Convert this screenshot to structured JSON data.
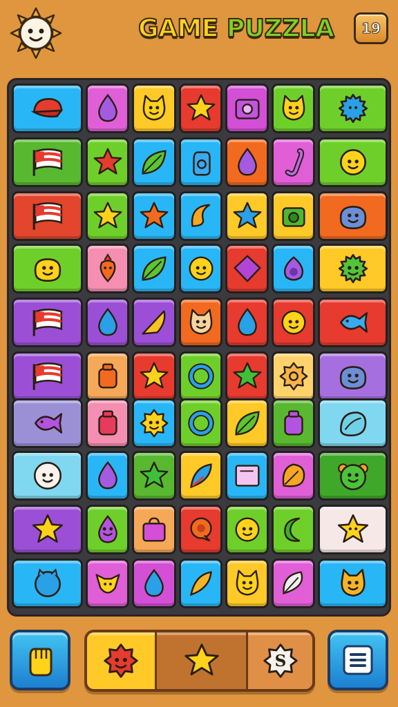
{
  "header": {
    "title_word1": "GAME",
    "title_word2": "PUZZLA",
    "level": "19"
  },
  "colors": {
    "background": "#e0963e",
    "board": "#3b3a3e",
    "title_yellow": "#ffd21c",
    "title_green": "#7ed321"
  },
  "board": {
    "rows": [
      [
        {
          "color": "#29b6f6",
          "icon": "red-cap"
        },
        {
          "color": "#e05fd7",
          "icon": "purple-blob"
        },
        {
          "color": "#ffc928",
          "icon": "yellow-cat-face"
        },
        {
          "color": "#e63b2e",
          "icon": "yellow-star"
        },
        {
          "color": "#d34fd6",
          "icon": "purple-camera"
        },
        {
          "color": "#6fcf2a",
          "icon": "yellow-cat-face"
        },
        {
          "color": "#6fcf2a",
          "icon": "blue-fuzzball"
        }
      ],
      [
        {
          "color": "#58b82f",
          "icon": "red-flag"
        },
        {
          "color": "#6fcf2a",
          "icon": "red-star"
        },
        {
          "color": "#29b6f6",
          "icon": "green-leaf"
        },
        {
          "color": "#29b6f6",
          "icon": "blue-hand"
        },
        {
          "color": "#f26a1f",
          "icon": "purple-drop"
        },
        {
          "color": "#e05fd7",
          "icon": "purple-hook"
        },
        {
          "color": "#6fcf2a",
          "icon": "yellow-smiley"
        }
      ],
      [
        {
          "color": "#e2462c",
          "icon": "red-flag"
        },
        {
          "color": "#6fcf2a",
          "icon": "yellow-star"
        },
        {
          "color": "#29b6f6",
          "icon": "orange-star"
        },
        {
          "color": "#29b6f6",
          "icon": "orange-crescent"
        },
        {
          "color": "#ffc928",
          "icon": "blue-star"
        },
        {
          "color": "#ffc928",
          "icon": "green-camera"
        },
        {
          "color": "#f26a1f",
          "icon": "blue-blob-face"
        }
      ],
      [
        {
          "color": "#6fcf2a",
          "icon": "yellow-face"
        },
        {
          "color": "#f48fb1",
          "icon": "orange-carrot"
        },
        {
          "color": "#29b6f6",
          "icon": "green-leaf"
        },
        {
          "color": "#29b6f6",
          "icon": "yellow-smiley"
        },
        {
          "color": "#e63b2e",
          "icon": "purple-diamond"
        },
        {
          "color": "#29b6f6",
          "icon": "purple-onion"
        },
        {
          "color": "#ffc928",
          "icon": "green-fuzzball"
        }
      ],
      [
        {
          "color": "#9b4fd6",
          "icon": "red-flag"
        },
        {
          "color": "#9b4fd6",
          "icon": "blue-blob"
        },
        {
          "color": "#9b4fd6",
          "icon": "yellow-cone"
        },
        {
          "color": "#f26a1f",
          "icon": "cat-face"
        },
        {
          "color": "#e63b2e",
          "icon": "blue-drop"
        },
        {
          "color": "#e63b2e",
          "icon": "yellow-smiley"
        },
        {
          "color": "#e63b2e",
          "icon": "blue-fish"
        }
      ],
      [
        {
          "color": "#9b4fd6",
          "icon": "red-flag"
        },
        {
          "color": "#f5a857",
          "icon": "orange-jar"
        },
        {
          "color": "#e63b2e",
          "icon": "yellow-star"
        },
        {
          "color": "#6fcf2a",
          "icon": "blue-ring"
        },
        {
          "color": "#e63b2e",
          "icon": "green-star"
        },
        {
          "color": "#ffd26b",
          "icon": "orange-sun"
        },
        {
          "color": "#a66fe0",
          "icon": "blue-blob-face"
        }
      ],
      [
        {
          "color": "#9b8fd6",
          "icon": "purple-fish"
        },
        {
          "color": "#f48fb1",
          "icon": "red-jar"
        },
        {
          "color": "#29b6f6",
          "icon": "yellow-sun"
        },
        {
          "color": "#6fcf2a",
          "icon": "blue-ring"
        },
        {
          "color": "#ffc928",
          "icon": "green-leaf"
        },
        {
          "color": "#58b82f",
          "icon": "purple-jar"
        },
        {
          "color": "#7fd8f0",
          "icon": "blue-shell"
        }
      ],
      [
        {
          "color": "#7fd8f0",
          "icon": "white-face"
        },
        {
          "color": "#29b6f6",
          "icon": "purple-drop"
        },
        {
          "color": "#58b82f",
          "icon": "green-star"
        },
        {
          "color": "#ffc928",
          "icon": "blue-feather"
        },
        {
          "color": "#29b6f6",
          "icon": "pink-card"
        },
        {
          "color": "#e05fd7",
          "icon": "orange-leaf"
        },
        {
          "color": "#3fa82a",
          "icon": "green-face"
        }
      ],
      [
        {
          "color": "#9b4fd6",
          "icon": "yellow-star"
        },
        {
          "color": "#6fcf2a",
          "icon": "purple-face"
        },
        {
          "color": "#f5a857",
          "icon": "pink-bag"
        },
        {
          "color": "#e63b2e",
          "icon": "orange-bubble"
        },
        {
          "color": "#6fcf2a",
          "icon": "yellow-smiley"
        },
        {
          "color": "#6fcf2a",
          "icon": "green-crescent"
        },
        {
          "color": "#f7e8e8",
          "icon": "yellow-star-face"
        }
      ],
      [
        {
          "color": "#29b6f6",
          "icon": "blue-cat-ball"
        },
        {
          "color": "#e05fd7",
          "icon": "yellow-fox"
        },
        {
          "color": "#d34fd6",
          "icon": "blue-drop"
        },
        {
          "color": "#29b6f6",
          "icon": "orange-feather"
        },
        {
          "color": "#ffc928",
          "icon": "yellow-cat-face"
        },
        {
          "color": "#e05fd7",
          "icon": "white-leaf"
        },
        {
          "color": "#29b6f6",
          "icon": "orange-cat-face"
        }
      ]
    ]
  },
  "bottom_bar": {
    "left_button_icon": "fist-icon",
    "powerups": [
      {
        "color": "#ffc928",
        "icon": "red-sun"
      },
      {
        "color": "#c0722f",
        "icon": "yellow-star"
      },
      {
        "color": "#e08f47",
        "icon": "coin-s"
      }
    ],
    "coin_label": "S",
    "right_button_icon": "menu-icon"
  }
}
